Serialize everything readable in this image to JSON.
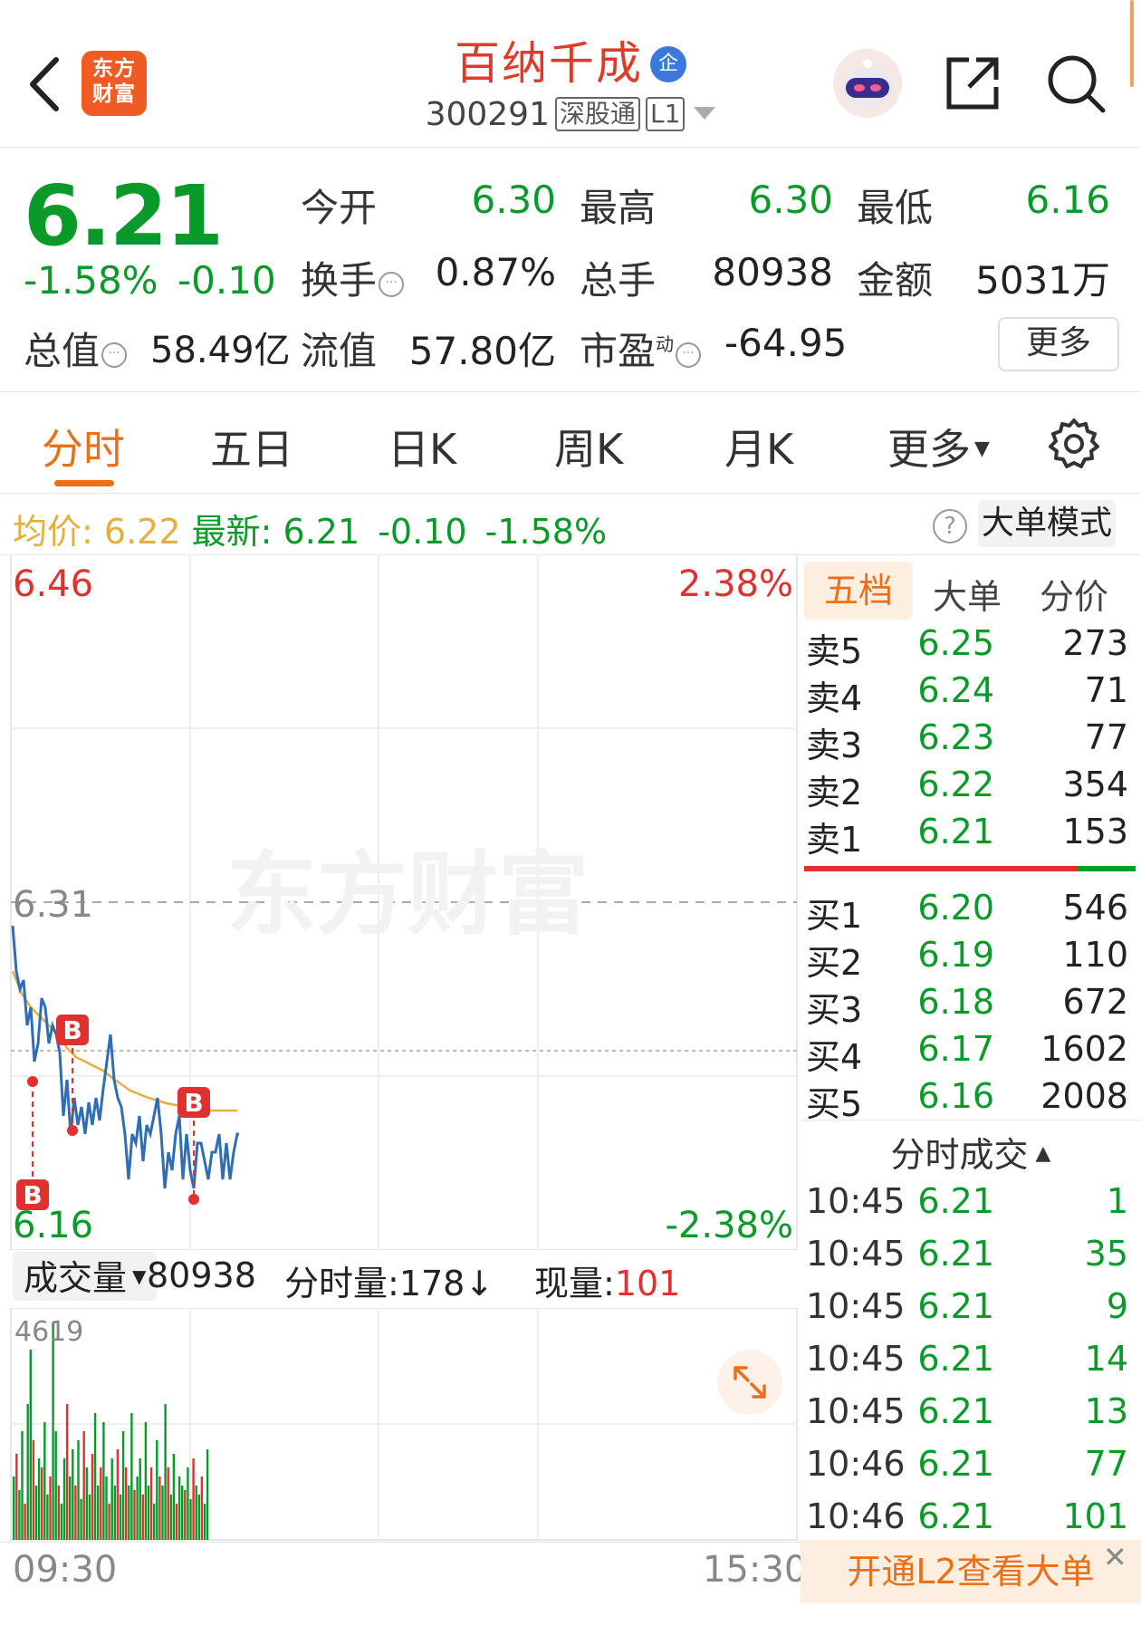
{
  "header": {
    "logo_text_line1": "东方",
    "logo_text_line2": "财富",
    "stock_name": "百纳千成",
    "enterprise_badge": "企",
    "stock_code": "300291",
    "tag_connect": "深股通",
    "tag_level": "L1"
  },
  "quote": {
    "price": "6.21",
    "change_pct": "-1.58%",
    "change_amt": "-0.10",
    "open_label": "今开",
    "open": "6.30",
    "high_label": "最高",
    "high": "6.30",
    "low_label": "最低",
    "low": "6.16",
    "turnover_label": "换手",
    "turnover": "0.87%",
    "volume_label": "总手",
    "volume": "80938",
    "amount_label": "金额",
    "amount": "5031万",
    "total_mv_label": "总值",
    "total_mv": "58.49亿",
    "float_mv_label": "流值",
    "float_mv": "57.80亿",
    "pe_label": "市盈",
    "pe_sup": "动",
    "pe": "-64.95",
    "more_button": "更多"
  },
  "tabs": [
    "分时",
    "五日",
    "日K",
    "周K",
    "月K",
    "更多"
  ],
  "avgline": {
    "avg_label": "均价:",
    "avg": "6.22",
    "latest_label": "最新:",
    "latest": "6.21",
    "chg": "-0.10",
    "pct": "-1.58%",
    "help": "?",
    "mode_button": "大单模式"
  },
  "chart": {
    "y_top": "6.46",
    "y_mid": "6.31",
    "y_bottom": "6.16",
    "pct_top": "2.38%",
    "pct_bottom": "-2.38%",
    "watermark": "东方财富",
    "marker_label": "B",
    "time_start": "09:30",
    "time_end": "15:30"
  },
  "volume_bar": {
    "selector_label": "成交量",
    "total": "80938",
    "minute_label": "分时量:",
    "minute": "178↓",
    "current_label": "现量:",
    "current": "101",
    "max_label": "4619"
  },
  "orderbook": {
    "tabs": [
      "五档",
      "大单",
      "分价"
    ],
    "asks": [
      {
        "label": "卖5",
        "price": "6.25",
        "vol": "273"
      },
      {
        "label": "卖4",
        "price": "6.24",
        "vol": "71"
      },
      {
        "label": "卖3",
        "price": "6.23",
        "vol": "77"
      },
      {
        "label": "卖2",
        "price": "6.22",
        "vol": "354"
      },
      {
        "label": "卖1",
        "price": "6.21",
        "vol": "153"
      }
    ],
    "bids": [
      {
        "label": "买1",
        "price": "6.20",
        "vol": "546"
      },
      {
        "label": "买2",
        "price": "6.19",
        "vol": "110"
      },
      {
        "label": "买3",
        "price": "6.18",
        "vol": "672"
      },
      {
        "label": "买4",
        "price": "6.17",
        "vol": "1602"
      },
      {
        "label": "买5",
        "price": "6.16",
        "vol": "2008"
      }
    ],
    "ticks_title": "分时成交",
    "ticks": [
      {
        "time": "10:45",
        "price": "6.21",
        "vol": "1"
      },
      {
        "time": "10:45",
        "price": "6.21",
        "vol": "35"
      },
      {
        "time": "10:45",
        "price": "6.21",
        "vol": "9"
      },
      {
        "time": "10:45",
        "price": "6.21",
        "vol": "14"
      },
      {
        "time": "10:45",
        "price": "6.21",
        "vol": "13"
      },
      {
        "time": "10:46",
        "price": "6.21",
        "vol": "77"
      },
      {
        "time": "10:46",
        "price": "6.21",
        "vol": "101"
      }
    ],
    "cta": "开通L2查看大单",
    "cta_close": "✕"
  },
  "colors": {
    "up": "#e03030",
    "down": "#0a9a2a",
    "accent": "#e8701a",
    "price_line": "#2f6db5",
    "avg_line": "#e3b040"
  }
}
